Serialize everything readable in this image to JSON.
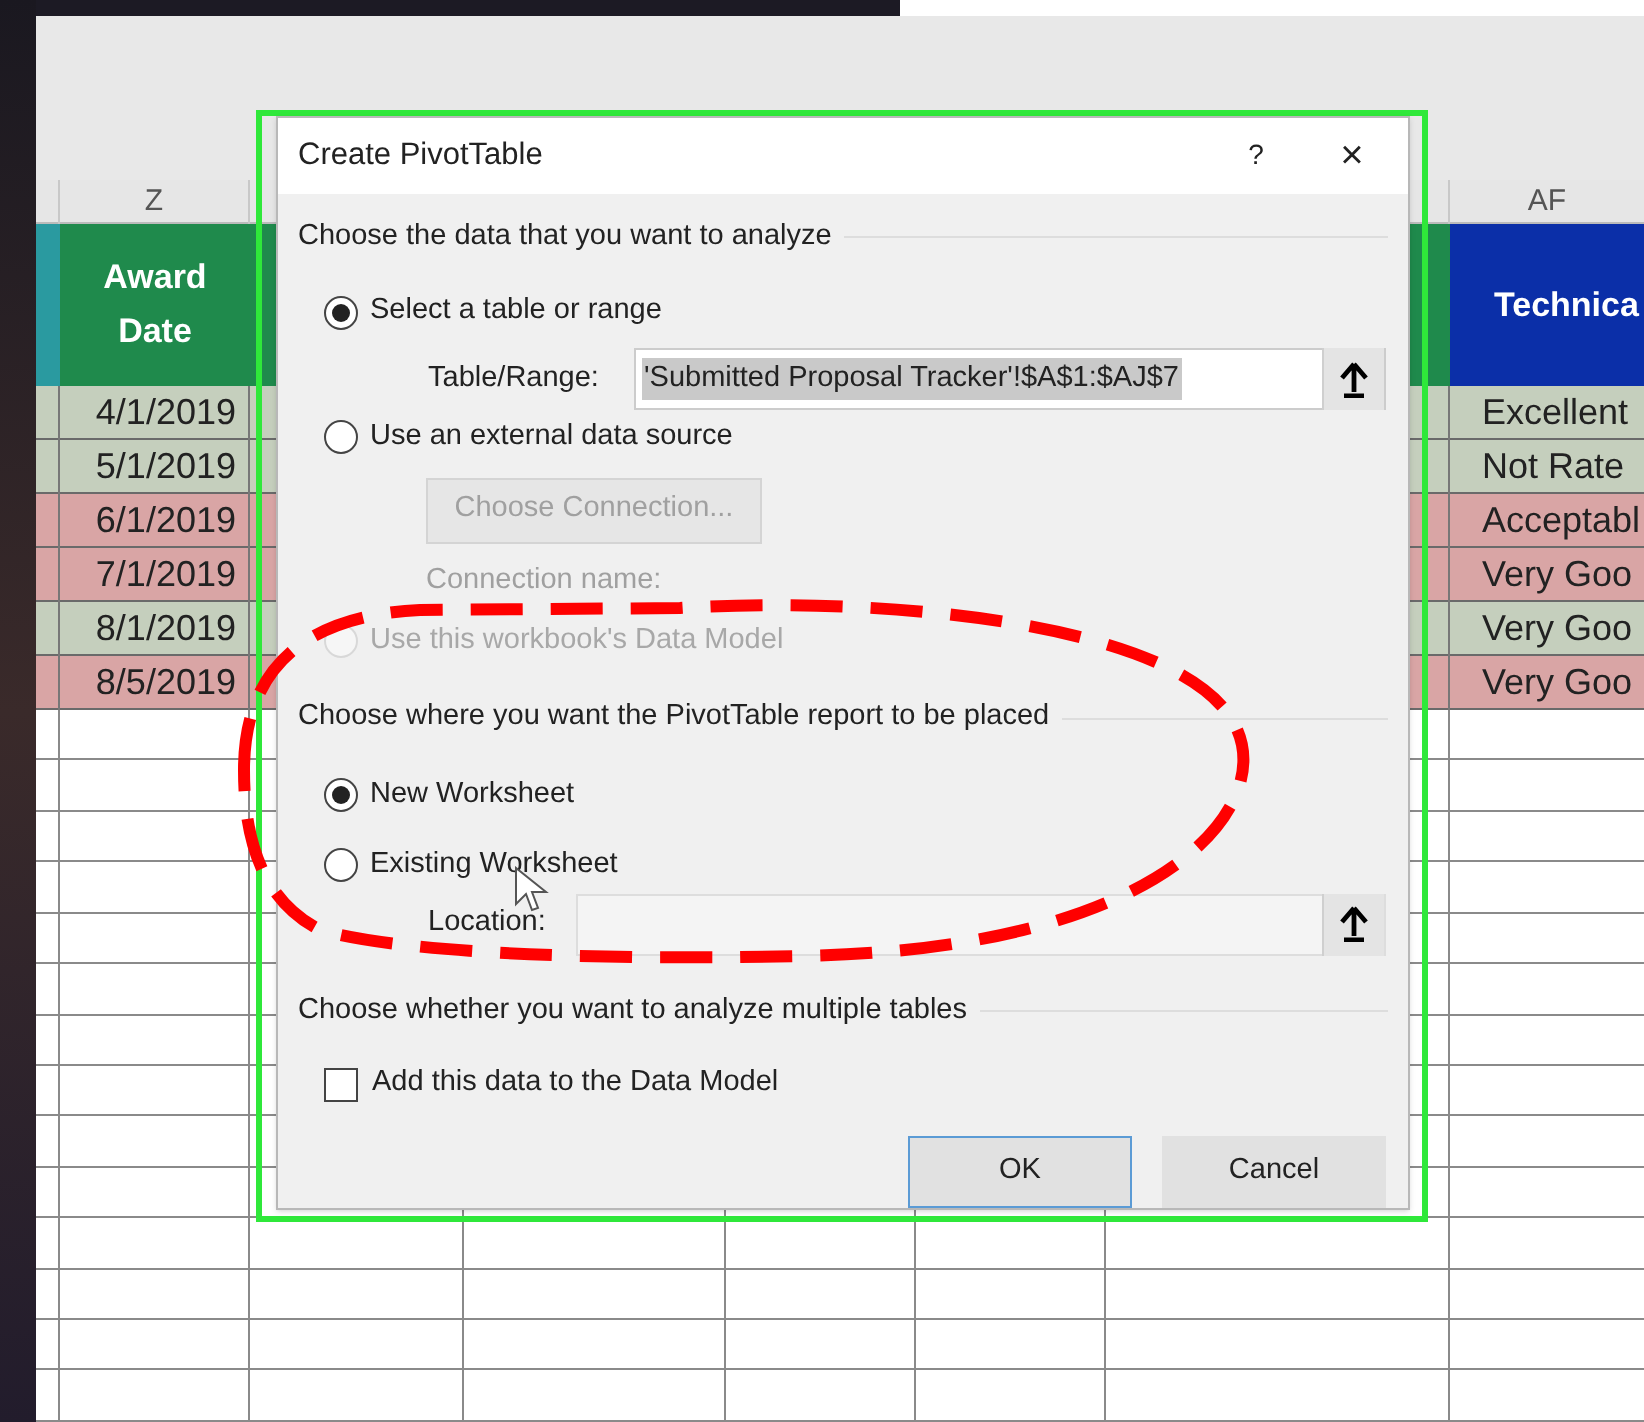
{
  "sheet": {
    "columns": [
      {
        "label": "Z"
      },
      {
        "label": "AF"
      }
    ],
    "header_cells": [
      {
        "text": "Award Date",
        "color": "#1f8a4c"
      },
      {
        "text": "Technica",
        "color": "#0b2fa8"
      }
    ],
    "rows": [
      {
        "award_date": "4/1/2019",
        "technical": "Excellent",
        "color": "#c5cfbd"
      },
      {
        "award_date": "5/1/2019",
        "technical": "Not Rate",
        "color": "#c5cfbd"
      },
      {
        "award_date": "6/1/2019",
        "technical": "Acceptabl",
        "color": "#d9a5a5"
      },
      {
        "award_date": "7/1/2019",
        "technical": "Very Goo",
        "color": "#d9a5a5"
      },
      {
        "award_date": "8/1/2019",
        "technical": "Very Goo",
        "color": "#c5cfbd"
      },
      {
        "award_date": "8/5/2019",
        "technical": "Very Goo",
        "color": "#d9a5a5"
      }
    ]
  },
  "dialog": {
    "title": "Create PivotTable",
    "help": "?",
    "close": "×",
    "source_label": "Choose the data that you want to analyze",
    "source_options": [
      {
        "label": "Select a table or range",
        "selected": true,
        "disabled": false
      },
      {
        "label": "Use an external data source",
        "selected": false,
        "disabled": false
      },
      {
        "label": "Use this workbook's Data Model",
        "selected": false,
        "disabled": true
      }
    ],
    "table_range": {
      "label": "Table/Range:",
      "value": "'Submitted Proposal Tracker'!$A$1:$AJ$7"
    },
    "choose_connection": {
      "label": "Choose Connection...",
      "disabled": true
    },
    "connection_name": "Connection name:",
    "placement_label": "Choose where you want the PivotTable report to be placed",
    "placement_options": [
      {
        "label": "New Worksheet",
        "selected": true
      },
      {
        "label": "Existing Worksheet",
        "selected": false
      }
    ],
    "location": {
      "label": "Location:"
    },
    "multiple_label": "Choose whether you want to analyze multiple tables",
    "data_model_checkbox": {
      "label": "Add this data to the Data Model",
      "checked": false
    },
    "buttons": [
      {
        "label": "OK",
        "default": true
      },
      {
        "label": "Cancel",
        "default": false
      }
    ]
  }
}
